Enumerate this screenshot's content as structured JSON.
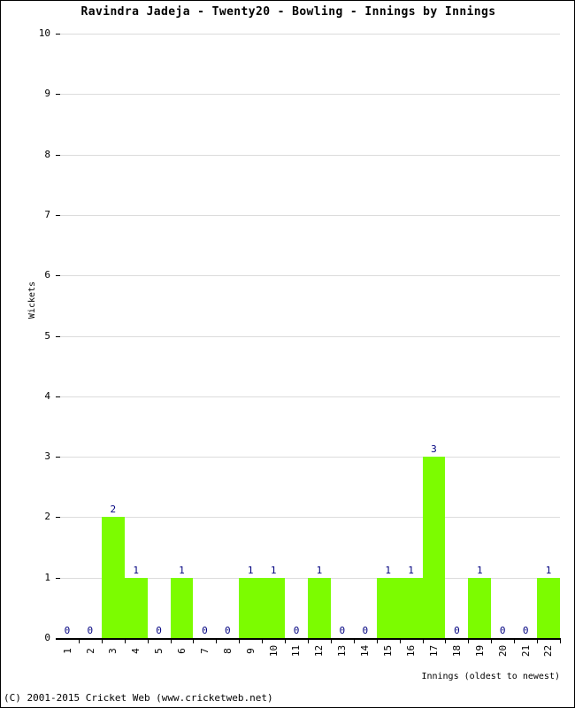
{
  "chart_data": {
    "type": "bar",
    "title": "Ravindra Jadeja - Twenty20 - Bowling - Innings by Innings",
    "xlabel": "Innings (oldest to newest)",
    "ylabel": "Wickets",
    "categories": [
      "1",
      "2",
      "3",
      "4",
      "5",
      "6",
      "7",
      "8",
      "9",
      "10",
      "11",
      "12",
      "13",
      "14",
      "15",
      "16",
      "17",
      "18",
      "19",
      "20",
      "21",
      "22"
    ],
    "values": [
      0,
      0,
      2,
      1,
      0,
      1,
      0,
      0,
      1,
      1,
      0,
      1,
      0,
      0,
      1,
      1,
      3,
      0,
      1,
      0,
      0,
      1
    ],
    "value_labels": [
      "0",
      "0",
      "2",
      "1",
      "0",
      "1",
      "0",
      "0",
      "1",
      "1",
      "0",
      "1",
      "0",
      "0",
      "1",
      "1",
      "3",
      "0",
      "1",
      "0",
      "0",
      "1"
    ],
    "ylim": [
      0,
      10
    ],
    "ytick_labels": [
      "0",
      "1",
      "2",
      "3",
      "4",
      "5",
      "6",
      "7",
      "8",
      "9",
      "10"
    ],
    "ytick_values": [
      0,
      1,
      2,
      3,
      4,
      5,
      6,
      7,
      8,
      9,
      10
    ],
    "grid": true,
    "legend": false,
    "bar_color": "#7CFC00",
    "value_label_color": "#000080",
    "grid_color": "#DCDCDC",
    "axis_color": "#000000"
  },
  "footer": {
    "copyright": "(C) 2001-2015 Cricket Web (www.cricketweb.net)"
  }
}
